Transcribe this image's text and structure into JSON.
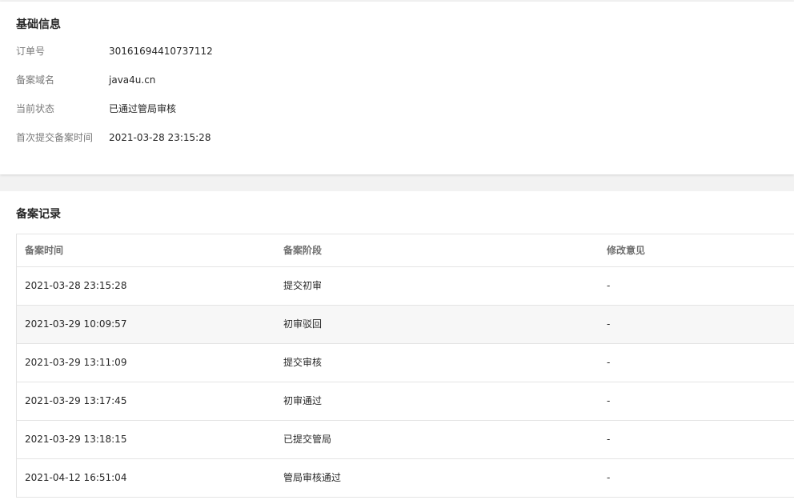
{
  "basic_info": {
    "title": "基础信息",
    "fields": [
      {
        "label": "订单号",
        "value": "30161694410737112"
      },
      {
        "label": "备案域名",
        "value": "java4u.cn"
      },
      {
        "label": "当前状态",
        "value": "已通过管局审核"
      },
      {
        "label": "首次提交备案时间",
        "value": "2021-03-28 23:15:28"
      }
    ]
  },
  "records": {
    "title": "备案记录",
    "columns": [
      "备案时间",
      "备案阶段",
      "修改意见"
    ],
    "rows": [
      {
        "time": "2021-03-28 23:15:28",
        "stage": "提交初审",
        "comment": "-"
      },
      {
        "time": "2021-03-29 10:09:57",
        "stage": "初审驳回",
        "comment": "-"
      },
      {
        "time": "2021-03-29 13:11:09",
        "stage": "提交审核",
        "comment": "-"
      },
      {
        "time": "2021-03-29 13:17:45",
        "stage": "初审通过",
        "comment": "-"
      },
      {
        "time": "2021-03-29 13:18:15",
        "stage": "已提交管局",
        "comment": "-"
      },
      {
        "time": "2021-04-12 16:51:04",
        "stage": "管局审核通过",
        "comment": "-"
      }
    ]
  }
}
